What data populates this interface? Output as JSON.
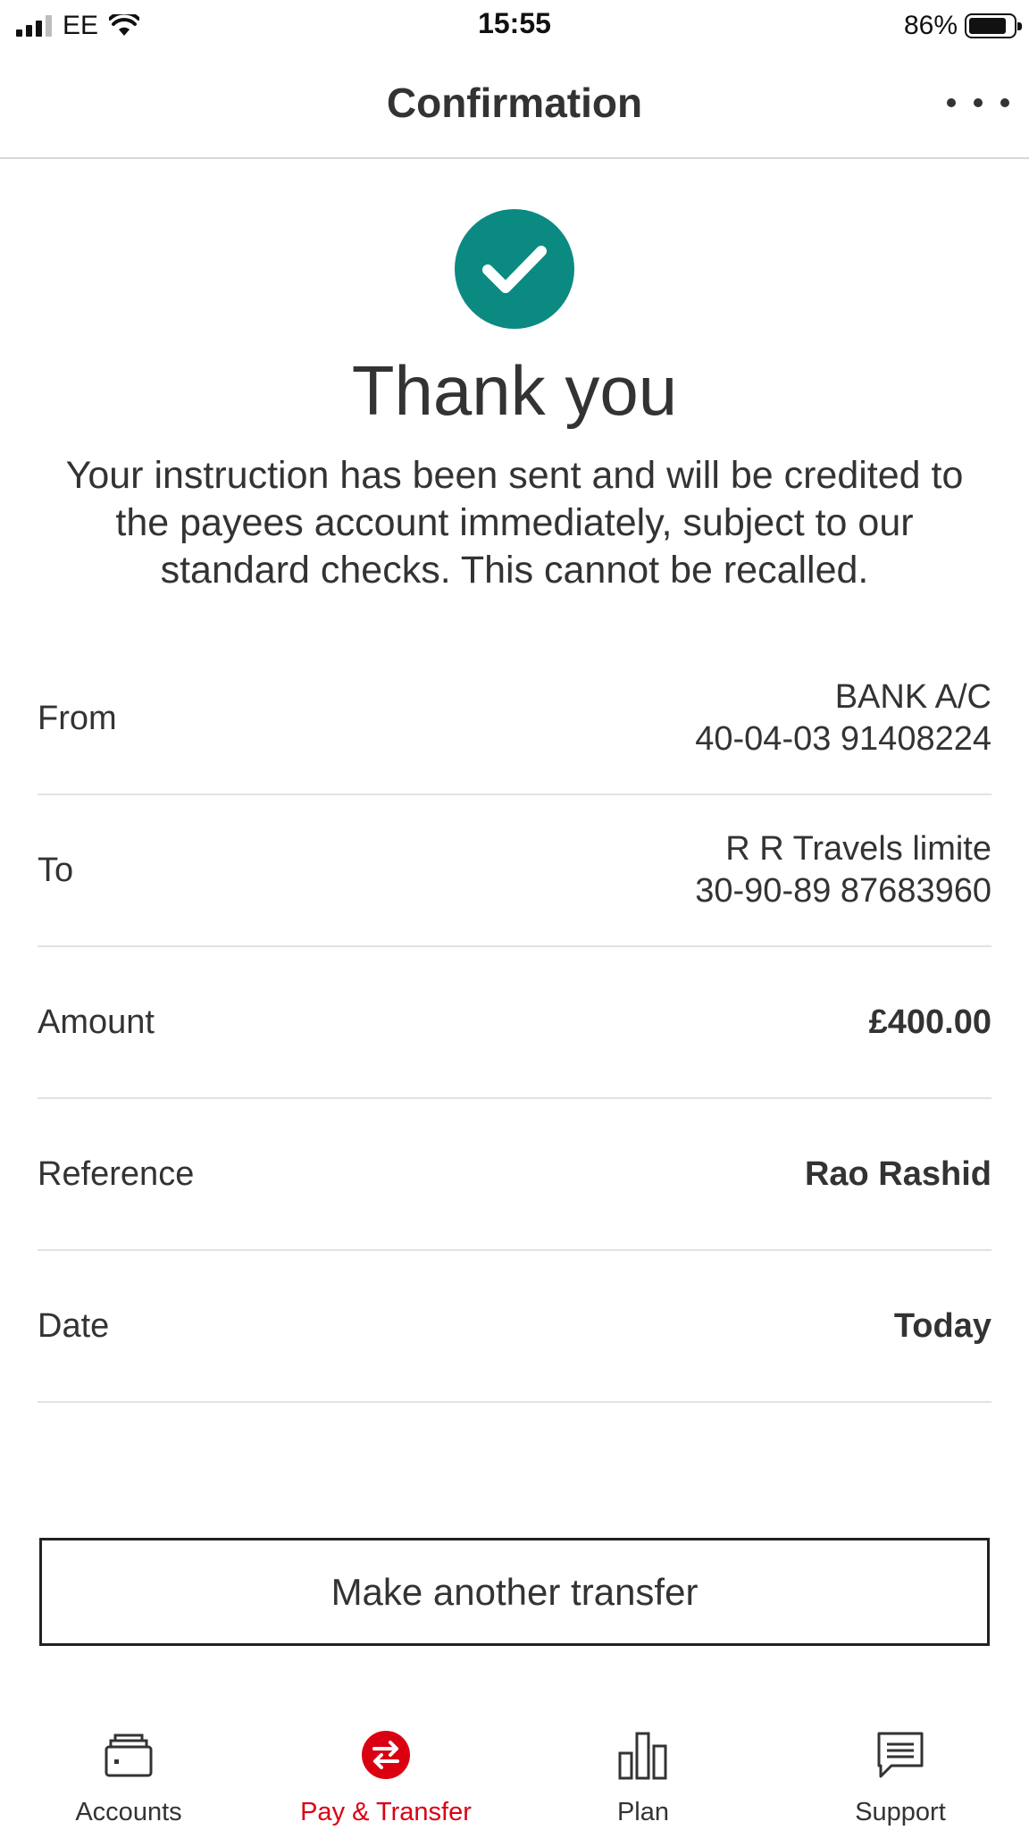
{
  "status_bar": {
    "carrier": "EE",
    "time": "15:55",
    "battery_percent": "86%",
    "battery_level": 0.86
  },
  "header": {
    "title": "Confirmation",
    "more_icon": "more-horizontal-icon"
  },
  "success": {
    "icon": "checkmark-icon",
    "icon_color": "#0b8a82",
    "heading": "Thank you",
    "message": "Your instruction has been sent and will be credited to the payees account immediately, subject to our standard checks.  This cannot be recalled."
  },
  "details": {
    "from": {
      "label": "From",
      "line1": "BANK A/C",
      "line2": "40-04-03 91408224"
    },
    "to": {
      "label": "To",
      "line1": "R R Travels limite",
      "line2": "30-90-89 87683960"
    },
    "amount": {
      "label": "Amount",
      "value": "£400.00"
    },
    "reference": {
      "label": "Reference",
      "value": "Rao Rashid"
    },
    "date": {
      "label": "Date",
      "value": "Today"
    }
  },
  "actions": {
    "transfer_label": "Make another transfer"
  },
  "tab_bar": {
    "accent_color": "#db0011",
    "tabs": [
      {
        "label": "Accounts",
        "icon": "wallet-icon",
        "active": false
      },
      {
        "label": "Pay & Transfer",
        "icon": "transfer-icon",
        "active": true
      },
      {
        "label": "Plan",
        "icon": "bar-chart-icon",
        "active": false
      },
      {
        "label": "Support",
        "icon": "chat-icon",
        "active": false
      }
    ]
  }
}
